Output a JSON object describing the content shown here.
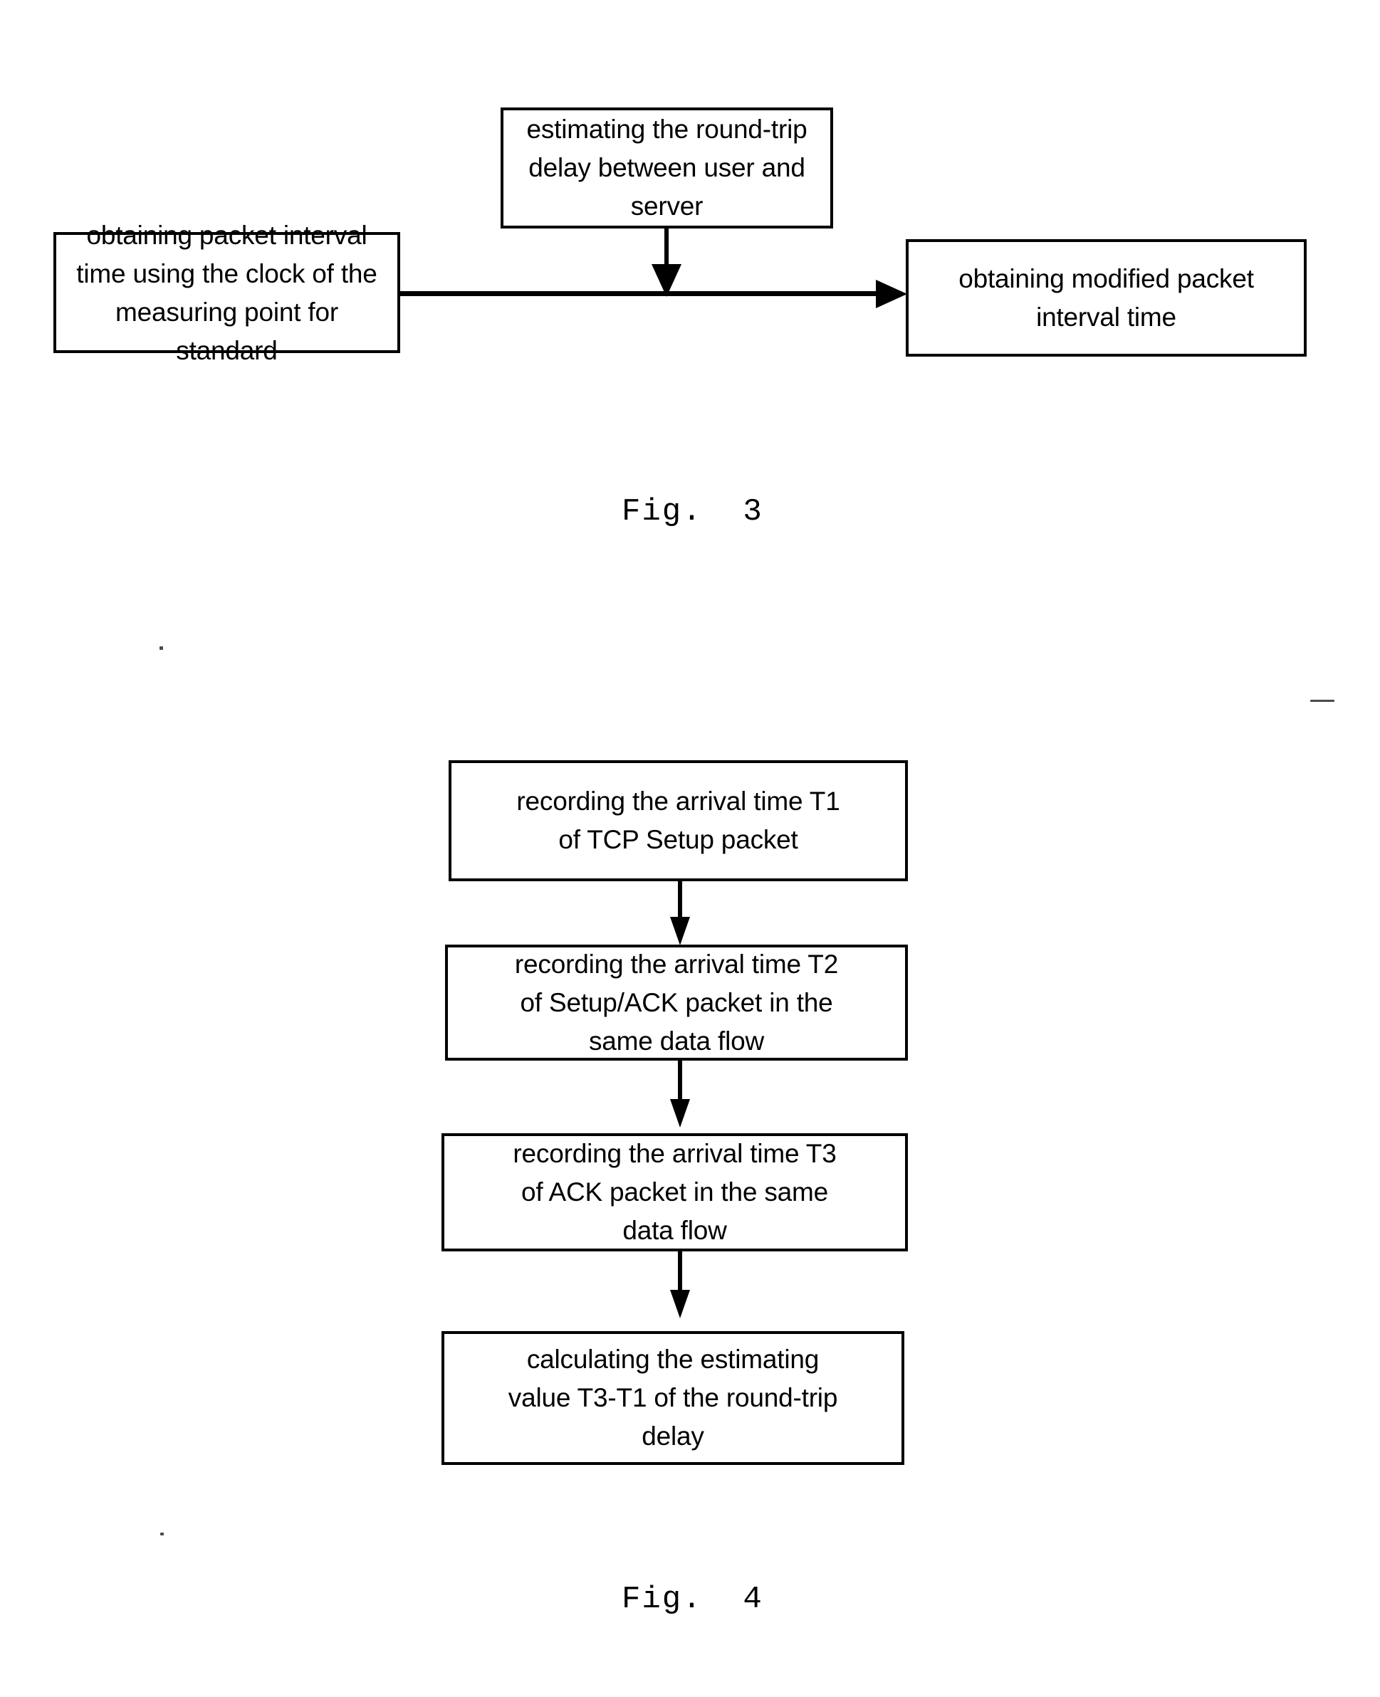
{
  "document": {
    "background_color": "#ffffff",
    "ink_color": "#000000"
  },
  "figures": [
    {
      "id": "fig3",
      "caption": "Fig.  3",
      "nodes": [
        {
          "id": "fig3-node-estimating-delay",
          "name": "estimating-round-trip-delay-box",
          "text": "estimating the round-trip\ndelay between user and\nserver"
        },
        {
          "id": "fig3-node-obtaining-interval",
          "name": "obtaining-packet-interval-time-box",
          "text": "obtaining packet interval\ntime using the clock of the\nmeasuring point for\nstandard"
        },
        {
          "id": "fig3-node-modified-interval",
          "name": "obtaining-modified-packet-interval-time-box",
          "text": "obtaining modified packet\ninterval time"
        }
      ],
      "connectors": [
        {
          "id": "fig3-arrow-down",
          "name": "arrow-estimating-to-flow",
          "direction": "down",
          "from": "fig3-node-estimating-delay",
          "to": "fig3-arrow-right"
        },
        {
          "id": "fig3-arrow-right",
          "name": "arrow-interval-to-modified",
          "direction": "right",
          "from": "fig3-node-obtaining-interval",
          "to": "fig3-node-modified-interval"
        }
      ]
    },
    {
      "id": "fig4",
      "caption": "Fig.  4",
      "nodes": [
        {
          "id": "fig4-node-t1",
          "name": "recording-t1-box",
          "text": "recording the arrival time T1\nof  TCP Setup packet"
        },
        {
          "id": "fig4-node-t2",
          "name": "recording-t2-box",
          "text": "recording the arrival time T2\nof  Setup/ACK packet in the\nsame data flow"
        },
        {
          "id": "fig4-node-t3",
          "name": "recording-t3-box",
          "text": "recording the arrival time T3\nof ACK packet in the same\ndata flow"
        },
        {
          "id": "fig4-node-calc",
          "name": "calculating-estimating-value-box",
          "text": "calculating the estimating\nvalue T3-T1 of the round-trip\ndelay"
        }
      ],
      "connectors": [
        {
          "id": "fig4-arrow-1",
          "name": "arrow-t1-to-t2",
          "direction": "down",
          "from": "fig4-node-t1",
          "to": "fig4-node-t2"
        },
        {
          "id": "fig4-arrow-2",
          "name": "arrow-t2-to-t3",
          "direction": "down",
          "from": "fig4-node-t2",
          "to": "fig4-node-t3"
        },
        {
          "id": "fig4-arrow-3",
          "name": "arrow-t3-to-calc",
          "direction": "down",
          "from": "fig4-node-t3",
          "to": "fig4-node-calc"
        }
      ]
    }
  ]
}
